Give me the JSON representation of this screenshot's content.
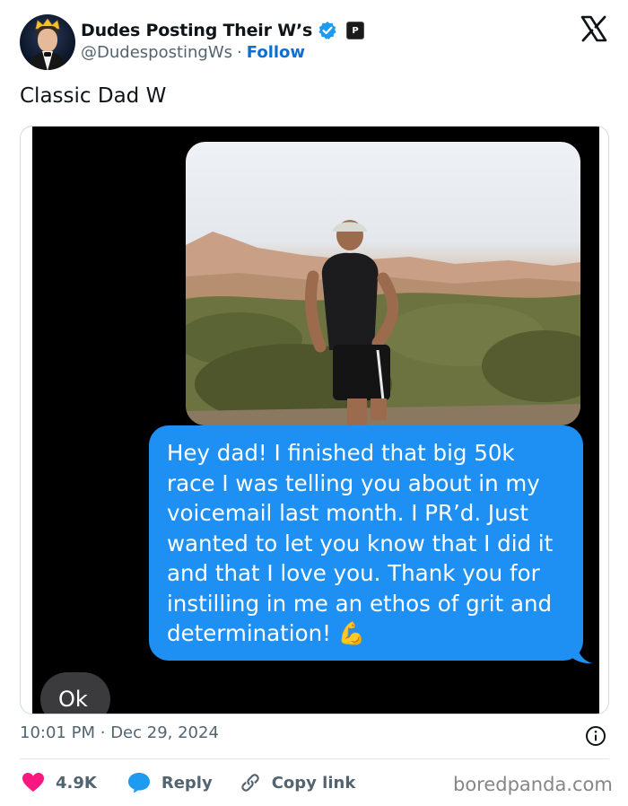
{
  "header": {
    "display_name": "Dudes Posting Their W’s",
    "handle": "@DudespostingWs",
    "separator": "·",
    "follow_label": "Follow",
    "verified_color": "#1d9bf0",
    "affiliate_badge_label": "P"
  },
  "icons": {
    "avatar": "avatar-crowned-man",
    "verified": "verified-badge-icon",
    "affiliate": "affiliate-badge-icon",
    "platform": "x-logo-icon",
    "info": "info-icon",
    "like": "heart-icon",
    "reply": "speech-bubble-icon",
    "copy": "link-icon"
  },
  "tweet": {
    "text": "Classic Dad W"
  },
  "media": {
    "message_lines": [
      "Hey dad! I finished that big 50k",
      "race I was telling you about in my",
      "voicemail last month. I PR’d. Just",
      "wanted to let you know that I did it",
      "and that I love you. Thank you for",
      "instilling in me an ethos of grit and",
      "determination!"
    ],
    "message_emoji": "💪",
    "reply_text": "Ok",
    "sent_bubble_color": "#1e90f3",
    "received_bubble_color": "#3b3b3d"
  },
  "footer": {
    "time": "10:01 PM",
    "separator": "·",
    "date": "Dec 29, 2024",
    "like_count": "4.9K",
    "reply_label": "Reply",
    "copy_label": "Copy link",
    "watermark": "boredpanda.com",
    "like_color": "#f91880",
    "reply_icon_color": "#1d9bf0"
  }
}
